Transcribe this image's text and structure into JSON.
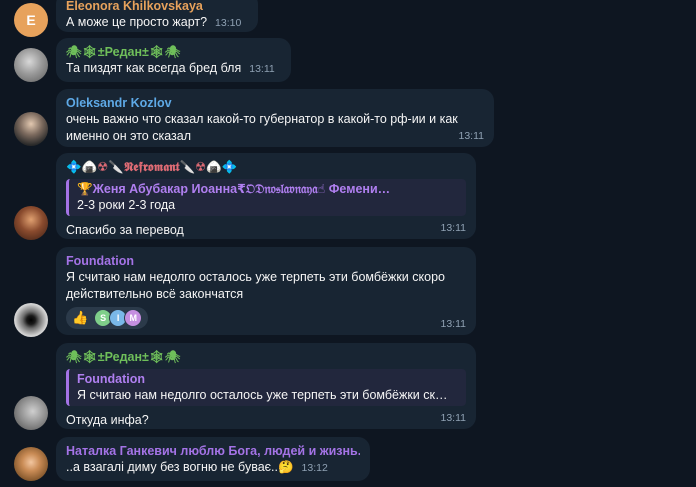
{
  "messages": [
    {
      "avatar_letter": "E",
      "name": "Eleonora Khilkovskaya",
      "name_color": "#e7a25c",
      "text": "А може це просто жарт?",
      "time": "13:10"
    },
    {
      "name": "🕷🕸±Редан±🕸🕷",
      "name_color": "#6fbf5a",
      "text": "Та пиздят как всегда бред бля",
      "time": "13:11"
    },
    {
      "name": "Oleksandr Kozlov",
      "name_color": "#5ea9e6",
      "text": "очень важно что сказал какой-то губернатор в какой-то рф-ии и как именно он это сказал",
      "time": "13:11"
    },
    {
      "name": "💠🍙☢🔪𝕹𝖊𝖋𝖗𝖔𝖒𝖆𝖓𝖙🔪☢🍙💠",
      "name_color": "#e06c75",
      "reply_name": "🏆Женя Абубакар Иоанна₹𝔒𝔇𝔫𝔬𝔰𝔩𝔞𝔳𝔫𝔞𝔶𝔞☝ Фемени…",
      "reply_text": "2-3 роки 2-3 года",
      "text": "Спасибо за перевод",
      "time": "13:11"
    },
    {
      "name": "Foundation",
      "name_color": "#a473e6",
      "text": "Я считаю нам недолго осталось уже терпеть эти бомбёжки скоро действительно всё закончатся",
      "time": "13:11",
      "reaction_emoji": "👍",
      "reaction_letters": [
        "S",
        "I",
        "M"
      ]
    },
    {
      "name": "🕷🕸±Редан±🕸🕷",
      "name_color": "#6fbf5a",
      "reply_name": "Foundation",
      "reply_text": "Я считаю нам недолго осталось уже терпеть эти бомбёжки ск…",
      "text": "Откуда инфа?",
      "time": "13:11"
    },
    {
      "name": "Наталка Ганкевич люблю Бога, людей и жизнь..",
      "name_color": "#a473e6",
      "text": "..а взагалі диму без вогню не буває..🤔",
      "time": "13:12"
    }
  ]
}
